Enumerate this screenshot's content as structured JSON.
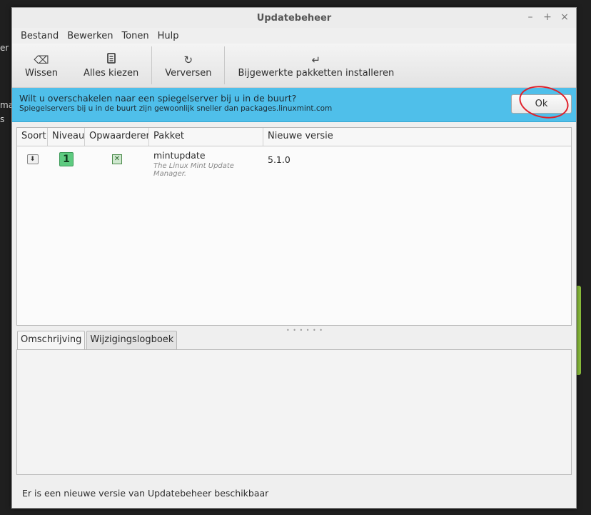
{
  "desktop": {
    "fragments": [
      "er",
      "ma",
      "s"
    ]
  },
  "window": {
    "title": "Updatebeheer",
    "controls": {
      "minimize": "–",
      "maximize": "+",
      "close": "×"
    }
  },
  "menubar": {
    "items": [
      "Bestand",
      "Bewerken",
      "Tonen",
      "Hulp"
    ]
  },
  "toolbar": {
    "clear": {
      "label": "Wissen",
      "icon": "backspace-icon"
    },
    "select_all": {
      "label": "Alles kiezen",
      "icon": "document-icon"
    },
    "refresh": {
      "label": "Verversen",
      "icon": "refresh-icon"
    },
    "install": {
      "label": "Bijgewerkte pakketten installeren",
      "icon": "enter-icon"
    }
  },
  "infobar": {
    "message": "Wilt u overschakelen naar een spiegelserver bij u in de buurt?",
    "detail": "Spiegelservers bij u in de buurt zijn gewoonlijk sneller dan packages.linuxmint.com",
    "ok_label": "Ok",
    "annotation_color": "#e0202a"
  },
  "list": {
    "columns": [
      "Soort",
      "Niveau",
      "Opwaarderen",
      "Pakket",
      "Nieuwe versie"
    ],
    "rows": [
      {
        "type_icon": "package-download-icon",
        "level": "1",
        "upgrade": true,
        "package": "mintupdate",
        "description": "The Linux Mint Update Manager.",
        "new_version": "5.1.0"
      }
    ]
  },
  "tabs": [
    "Omschrijving",
    "Wijzigingslogboek"
  ],
  "status": "Er is een nieuwe versie van Updatebeheer beschikbaar",
  "colors": {
    "infobar": "#4fbfea",
    "level1": "#5ecb80"
  }
}
